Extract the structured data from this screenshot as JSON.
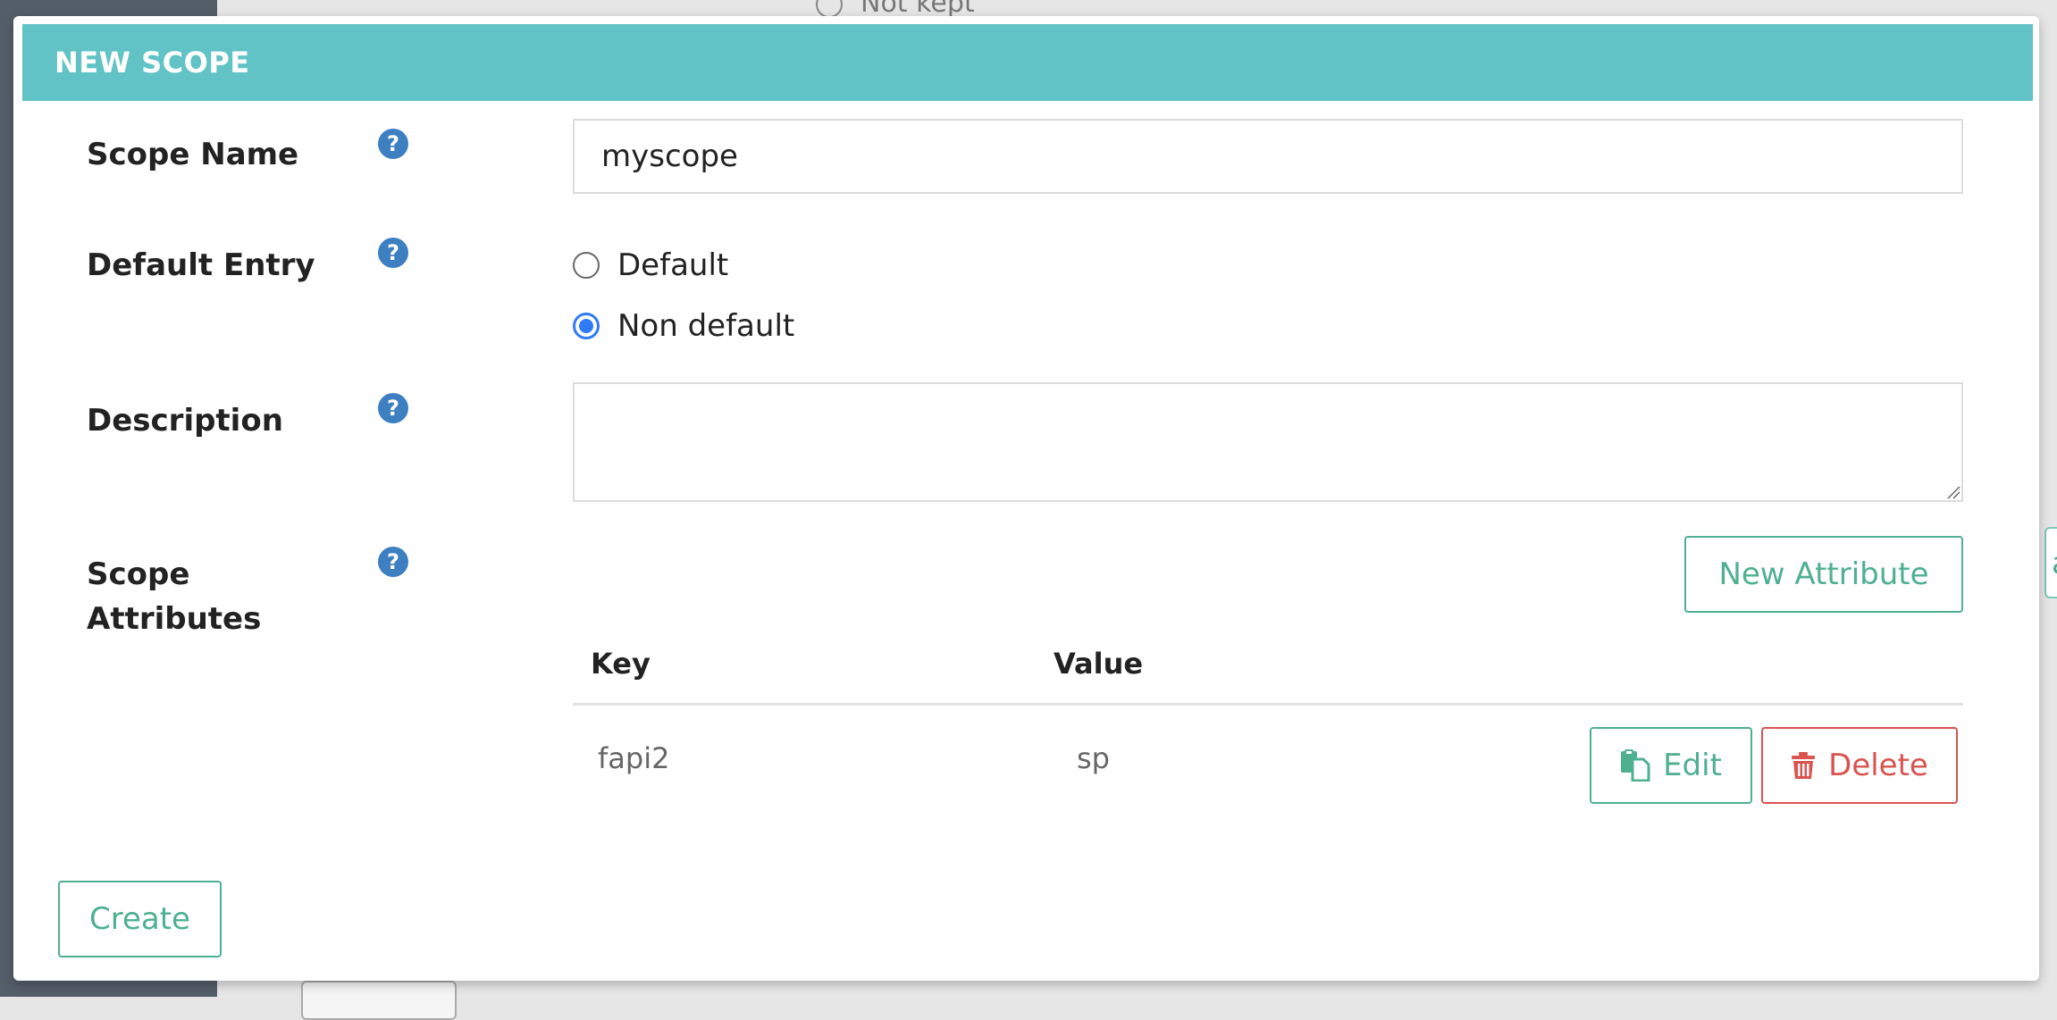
{
  "background": {
    "radio_label": "Not kept",
    "right_button_fragment": "a"
  },
  "modal": {
    "title": "NEW SCOPE",
    "fields": {
      "scope_name_label": "Scope Name",
      "scope_name_value": "myscope",
      "default_entry_label": "Default Entry",
      "default_entry_options": [
        {
          "label": "Default",
          "checked": false
        },
        {
          "label": "Non default",
          "checked": true
        }
      ],
      "description_label": "Description",
      "description_value": "",
      "scope_attributes_label_line1": "Scope",
      "scope_attributes_label_line2": "Attributes"
    },
    "help_icon_glyph": "?",
    "new_attribute_label": "New Attribute",
    "table": {
      "columns": [
        "Key",
        "Value"
      ],
      "rows": [
        {
          "key": "fapi2",
          "value": "sp"
        }
      ],
      "edit_label": "Edit",
      "delete_label": "Delete"
    },
    "create_label": "Create"
  },
  "colors": {
    "header": "#61c3c5",
    "help_icon": "#3d7fc1",
    "radio_checked": "#2f7bf5",
    "green": "#4fb08f",
    "red": "#d9534f"
  }
}
